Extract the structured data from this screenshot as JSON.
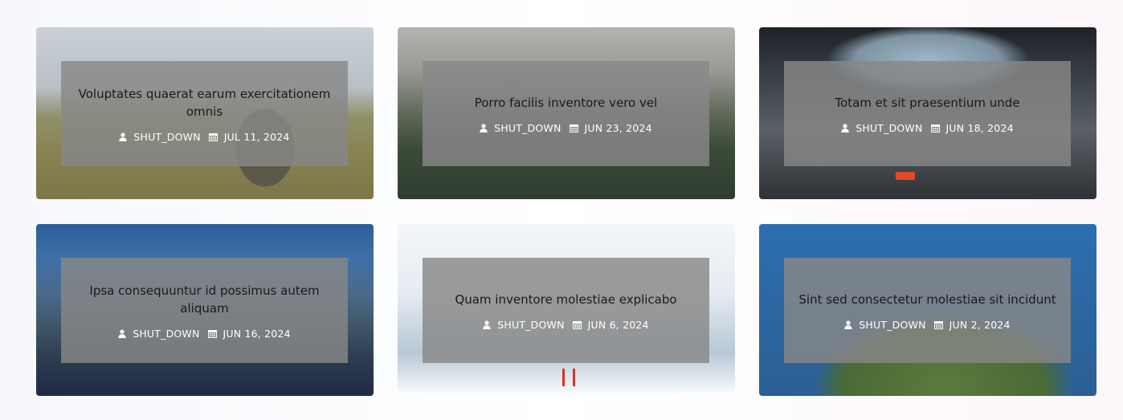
{
  "posts": [
    {
      "title": "Voluptates quaerat earum exercitationem omnis",
      "author": "SHUT_DOWN",
      "date": "JUL 11, 2024",
      "image": "old-truck-in-field"
    },
    {
      "title": "Porro facilis inventore vero vel",
      "author": "SHUT_DOWN",
      "date": "JUN 23, 2024",
      "image": "foggy-forest"
    },
    {
      "title": "Totam et sit praesentium unde",
      "author": "SHUT_DOWN",
      "date": "JUN 18, 2024",
      "image": "car-interior-road"
    },
    {
      "title": "Ipsa consequuntur id possimus autem aliquam",
      "author": "SHUT_DOWN",
      "date": "JUN 16, 2024",
      "image": "rocky-coast-blue"
    },
    {
      "title": "Quam inventore molestiae explicabo",
      "author": "SHUT_DOWN",
      "date": "JUN 6, 2024",
      "image": "seagull-beach"
    },
    {
      "title": "Sint sed consectetur molestiae sit incidunt",
      "author": "SHUT_DOWN",
      "date": "JUN 2, 2024",
      "image": "forest-island-aerial"
    }
  ],
  "icons": {
    "author": "user-icon",
    "date": "calendar-icon"
  }
}
